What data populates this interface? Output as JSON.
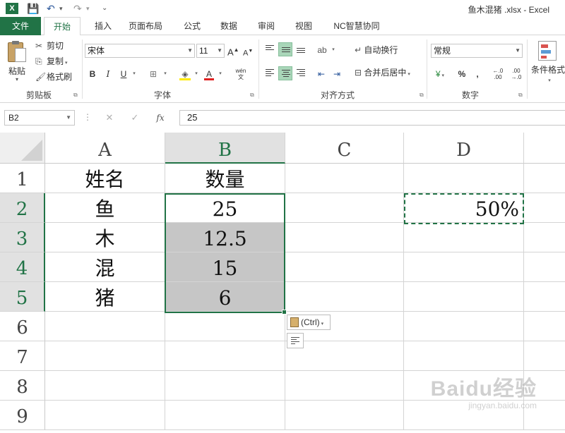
{
  "app": {
    "logo_letter": "X",
    "window_title": "鱼木混猪 .xlsx - Excel"
  },
  "quick_access": {
    "save": "💾",
    "undo": "↶",
    "redo": "↷",
    "more": "⌄"
  },
  "tabs": [
    "文件",
    "开始",
    "插入",
    "页面布局",
    "公式",
    "数据",
    "审阅",
    "视图",
    "NC智慧协同"
  ],
  "ribbon": {
    "clipboard": {
      "paste": "粘贴",
      "cut": "剪切",
      "copy": "复制",
      "format_painter": "格式刷",
      "group_label": "剪贴板"
    },
    "font": {
      "font_name": "宋体",
      "font_size": "11",
      "grow": "A",
      "shrink": "A",
      "bold": "B",
      "italic": "I",
      "underline": "U",
      "phonetic": "wén",
      "group_label": "字体"
    },
    "alignment": {
      "wrap_text": "自动换行",
      "merge_center": "合并后居中",
      "group_label": "对齐方式"
    },
    "number": {
      "format": "常规",
      "percent": "%",
      "comma": ",",
      "group_label": "数字"
    },
    "styles": {
      "conditional_format": "条件格式"
    }
  },
  "formula_bar": {
    "name_box": "B2",
    "fx": "fx",
    "value": "25"
  },
  "sheet": {
    "columns": [
      "A",
      "B",
      "C",
      "D"
    ],
    "rows": [
      "1",
      "2",
      "3",
      "4",
      "5",
      "6",
      "7",
      "8",
      "9"
    ],
    "cells": {
      "A1": "姓名",
      "B1": "数量",
      "A2": "鱼",
      "B2": "25",
      "D2": "50%",
      "A3": "木",
      "B3": "12.5",
      "A4": "混",
      "B4": "15",
      "A5": "猪",
      "B5": "6"
    },
    "selected_cell": "B2",
    "selected_range": "B2:B5",
    "copied_cell": "D2"
  },
  "paste_options": {
    "label": "(Ctrl)"
  },
  "watermark": {
    "brand": "Baidu经验",
    "url": "jingyan.baidu.com"
  },
  "colors": {
    "accent": "#217346",
    "selection_fill": "#c6c6c6",
    "header_selected": "#e1e1e1"
  }
}
